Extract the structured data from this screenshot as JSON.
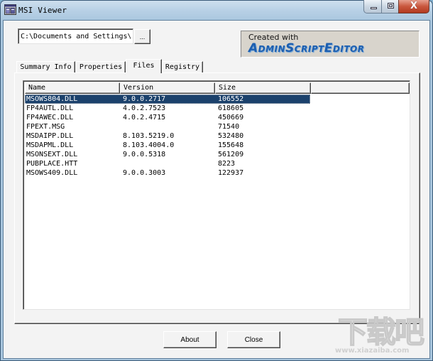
{
  "window": {
    "title": "MSI Viewer",
    "icon": "msi-viewer-app-icon",
    "caption_buttons": {
      "minimize": "minimize-icon",
      "maximize": "maximize-icon",
      "close": "close-icon",
      "close_glyph": "X"
    }
  },
  "toolbar": {
    "path_value": "C:\\Documents and Settings\\.",
    "browse_label": "..."
  },
  "logo": {
    "created_with": "Created with",
    "product": "AdminScriptEditor"
  },
  "tabs": [
    {
      "label": "Summary Info",
      "active": false
    },
    {
      "label": "Properties",
      "active": false
    },
    {
      "label": "Files",
      "active": true
    },
    {
      "label": "Registry",
      "active": false
    }
  ],
  "files": {
    "columns": [
      "Name",
      "Version",
      "Size",
      ""
    ],
    "selected_index": 0,
    "rows": [
      {
        "name": "MSOWS804.DLL",
        "version": "9.0.0.2717",
        "size": "106552"
      },
      {
        "name": "FP4AUTL.DLL",
        "version": "4.0.2.7523",
        "size": "618605"
      },
      {
        "name": "FP4AWEC.DLL",
        "version": "4.0.2.4715",
        "size": "450669"
      },
      {
        "name": "FPEXT.MSG",
        "version": "",
        "size": "71540"
      },
      {
        "name": "MSDAIPP.DLL",
        "version": "8.103.5219.0",
        "size": "532480"
      },
      {
        "name": "MSDAPML.DLL",
        "version": "8.103.4004.0",
        "size": "155648"
      },
      {
        "name": "MSONSEXT.DLL",
        "version": "9.0.0.5318",
        "size": "561209"
      },
      {
        "name": "PUBPLACE.HTT",
        "version": "",
        "size": "8223"
      },
      {
        "name": "MSOWS409.DLL",
        "version": "9.0.0.3003",
        "size": "122937"
      }
    ]
  },
  "buttons": {
    "about": "About",
    "close": "Close"
  },
  "watermark": {
    "big": "下载吧",
    "small": "www.xiazaiba.com"
  }
}
